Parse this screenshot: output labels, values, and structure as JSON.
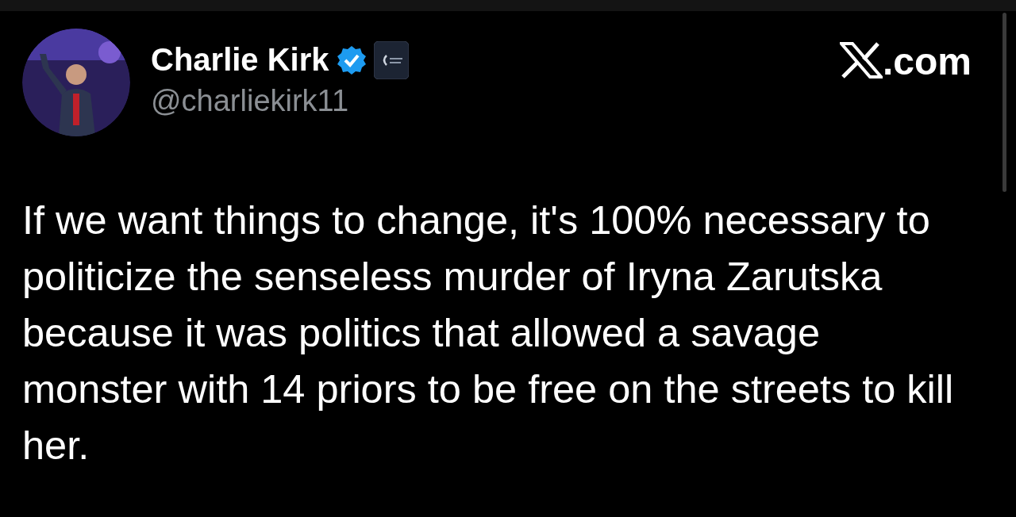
{
  "author": {
    "name": "Charlie Kirk",
    "verified": true,
    "handle": "@charliekirk11"
  },
  "site": {
    "label": ".com"
  },
  "post": {
    "text": "If we want things to change, it's 100% necessary to politicize the senseless murder of Iryna Zarutska because it was politics that allowed a savage monster with 14 priors to be free on the streets to kill her."
  }
}
